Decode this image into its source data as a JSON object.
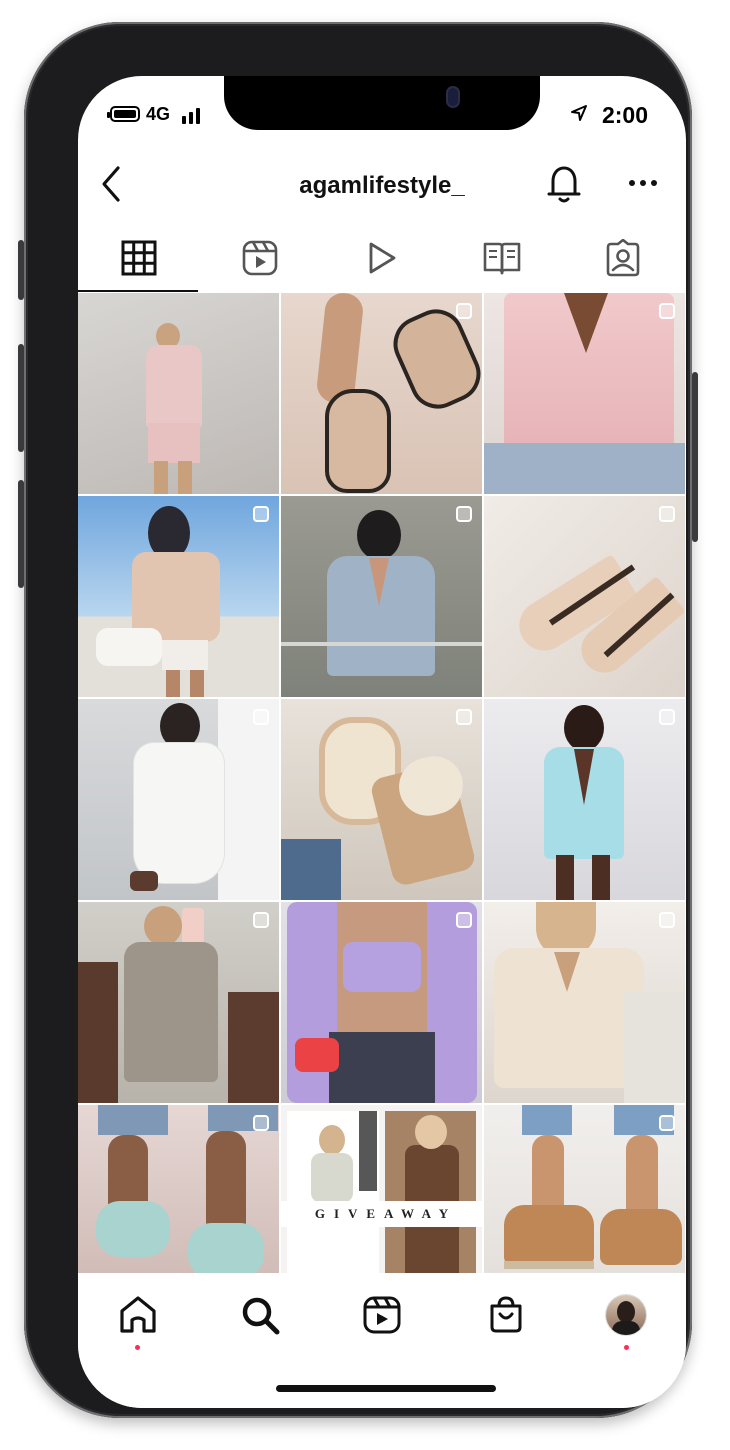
{
  "status_bar": {
    "network": "4G",
    "time": "2:00"
  },
  "header": {
    "username": "agamlifestyle_"
  },
  "tabs": [
    {
      "icon": "grid-icon",
      "active": true
    },
    {
      "icon": "reels-icon",
      "active": false
    },
    {
      "icon": "video-play-icon",
      "active": false
    },
    {
      "icon": "guide-book-icon",
      "active": false
    },
    {
      "icon": "tagged-user-icon",
      "active": false
    }
  ],
  "posts": [
    {
      "subject": "pink blazer and shorts outfit"
    },
    {
      "subject": "nude sandals"
    },
    {
      "subject": "pink satin shirt"
    },
    {
      "subject": "beige satin shirt with white bag"
    },
    {
      "subject": "blue blazer outfit"
    },
    {
      "subject": "studded heels"
    },
    {
      "subject": "white ruffle dress"
    },
    {
      "subject": "espadrille wedge sandals"
    },
    {
      "subject": "mint blazer suit"
    },
    {
      "subject": "taupe blazer dress mirror selfie"
    },
    {
      "subject": "lavender blazer with crop top"
    },
    {
      "subject": "cream cropped blazer"
    },
    {
      "subject": "mint bow slides"
    },
    {
      "subject": "giveaway post",
      "text": "GIVEAWAY"
    },
    {
      "subject": "tan strap sandals"
    }
  ],
  "bottom_nav": [
    {
      "icon": "home-icon",
      "badge": true
    },
    {
      "icon": "search-icon",
      "badge": false
    },
    {
      "icon": "reels-icon",
      "badge": false
    },
    {
      "icon": "shop-bag-icon",
      "badge": false
    },
    {
      "icon": "profile-avatar",
      "badge": true
    }
  ],
  "colors": {
    "badge": "#ff2d55",
    "text": "#111111",
    "phone_frame": "#1c1c1e"
  }
}
